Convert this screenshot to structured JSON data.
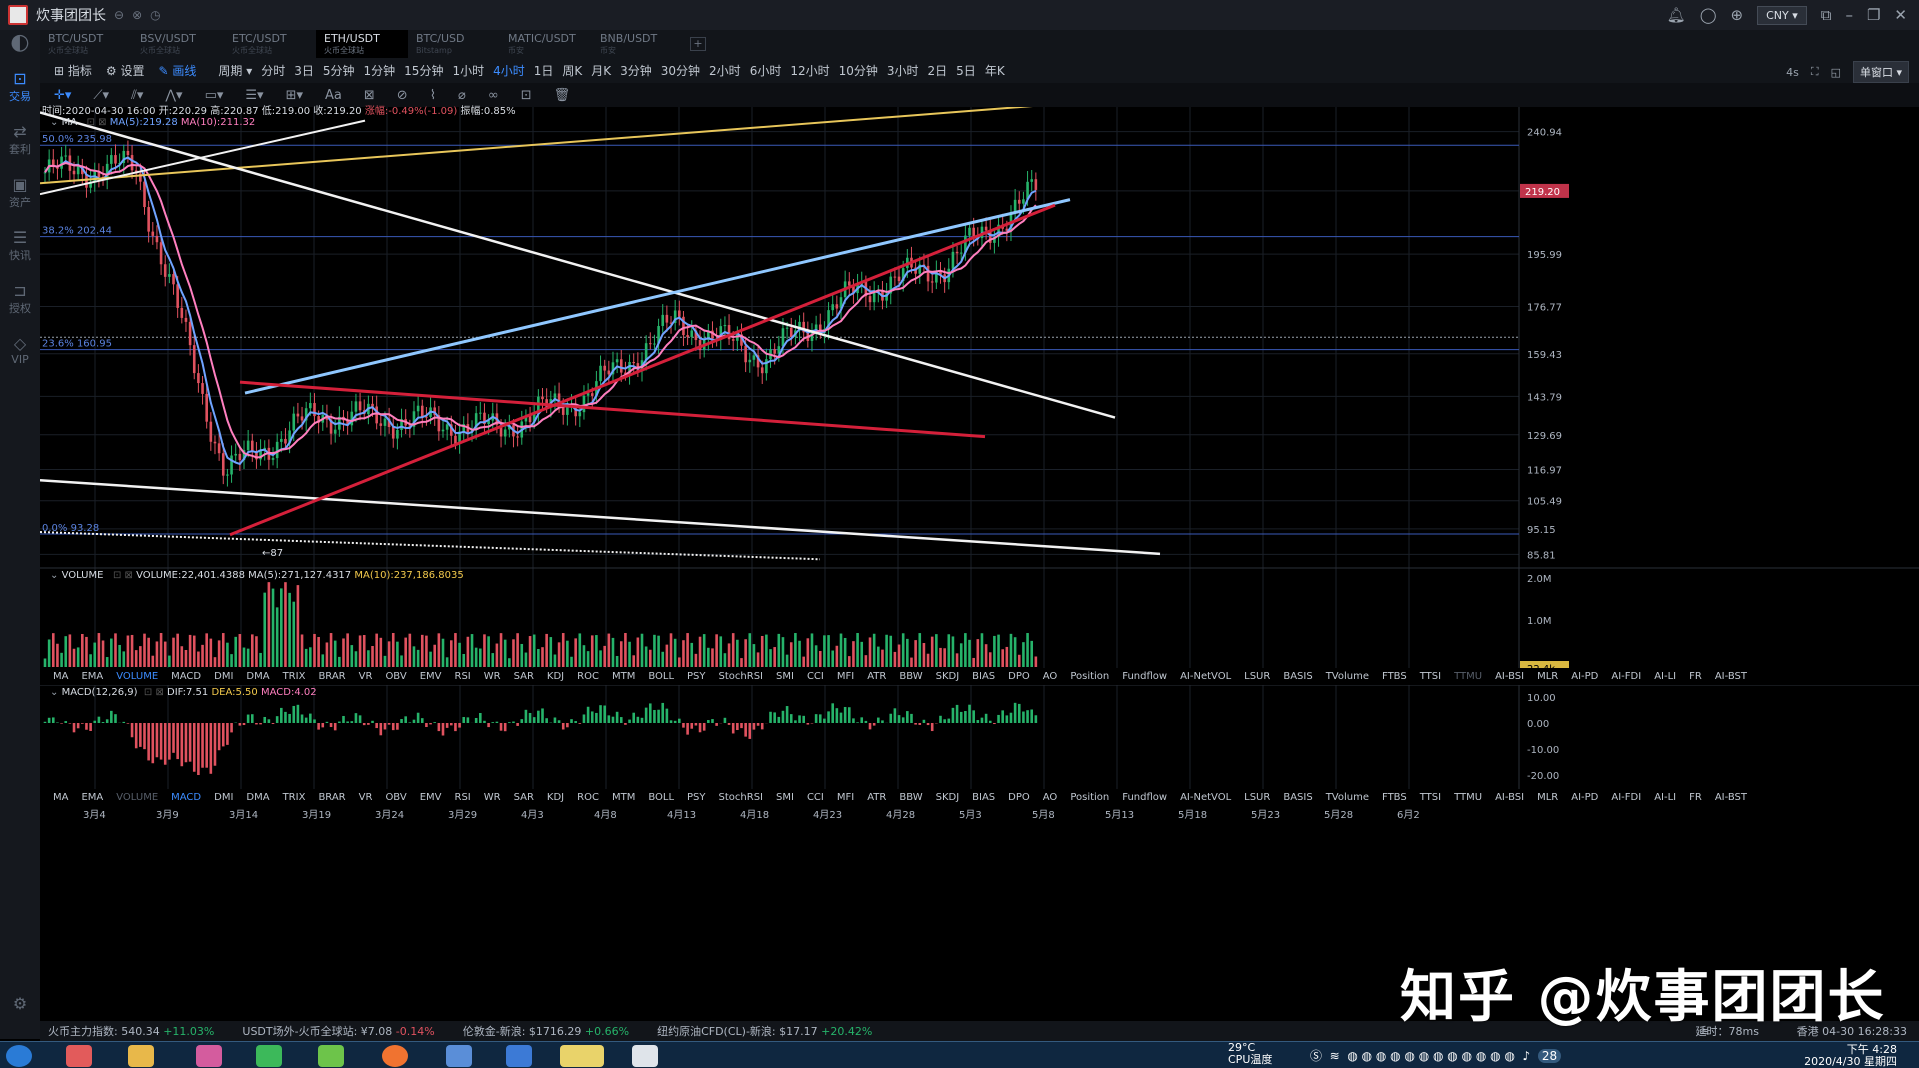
{
  "app": {
    "title": "炊事团团长"
  },
  "titlebar": {
    "currency": "CNY"
  },
  "tabs": [
    {
      "label": "BTC/USDT",
      "sub": "火币全球站"
    },
    {
      "label": "BSV/USDT",
      "sub": "火币全球站"
    },
    {
      "label": "ETC/USDT",
      "sub": "火币全球站"
    },
    {
      "label": "ETH/USDT",
      "sub": "火币全球站"
    },
    {
      "label": "BTC/USD",
      "sub": "Bitstamp"
    },
    {
      "label": "MATIC/USDT",
      "sub": "币安"
    },
    {
      "label": "BNB/USDT",
      "sub": "币安"
    }
  ],
  "tab_plus": "+",
  "sidebar": [
    {
      "label": "交易",
      "icon": "chart-icon"
    },
    {
      "label": "套利",
      "icon": "arbitrage-icon"
    },
    {
      "label": "资产",
      "icon": "asset-icon"
    },
    {
      "label": "快讯",
      "icon": "news-icon"
    },
    {
      "label": "授权",
      "icon": "auth-icon"
    },
    {
      "label": "VIP",
      "icon": "vip-icon"
    }
  ],
  "toolbar": {
    "indicator": "指标",
    "settings": "设置",
    "draw": "画线",
    "period": "周期",
    "periods": [
      "分时",
      "3日",
      "5分钟",
      "1分钟",
      "15分钟",
      "1小时",
      "4小时",
      "1日",
      "周K",
      "月K",
      "3分钟",
      "30分钟",
      "2小时",
      "6小时",
      "12小时",
      "10分钟",
      "3小时",
      "2日",
      "5日",
      "年K"
    ],
    "refresh": "4s",
    "window": "单窗口"
  },
  "draw_tools": {
    "text": "Aa"
  },
  "ohlc": {
    "time_label": "时间:2020-04-30 16:00",
    "open": "开:220.29",
    "high": "高:220.87",
    "low": "低:219.00",
    "close": "收:219.20",
    "change": "涨幅:-0.49%(-1.09)",
    "amplitude": "振幅:0.85%"
  },
  "ma_legend": {
    "name": "MA",
    "ma5": "MA(5):219.28",
    "ma10": "MA(10):211.32"
  },
  "fib_levels": [
    {
      "label": "50.0% 235.98",
      "y": 235.98
    },
    {
      "label": "38.2% 202.44",
      "y": 202.44
    },
    {
      "label": "23.6% 160.95",
      "y": 160.95
    },
    {
      "label": "0.0% 93.28",
      "y": 93.28
    }
  ],
  "price_axis": [
    "240.94",
    "219.20",
    "195.99",
    "176.77",
    "159.43",
    "143.79",
    "129.69",
    "116.97",
    "105.49",
    "95.15",
    "85.81"
  ],
  "last_price": "219.20",
  "low_marker": "←87",
  "volume_legend": {
    "name": "VOLUME",
    "volume": "VOLUME:22,401.4388",
    "ma5": "MA(5):271,127.4317",
    "ma10": "MA(10):237,186.8035"
  },
  "volume_axis": [
    "2.0M",
    "1.0M"
  ],
  "volume_last": "22.4k",
  "macd_legend": {
    "name": "MACD(12,26,9)",
    "dif": "DIF:7.51",
    "dea": "DEA:5.50",
    "macd": "MACD:4.02"
  },
  "macd_axis": [
    "10.00",
    "0.00",
    "-10.00",
    "-20.00"
  ],
  "indicators": [
    "MA",
    "EMA",
    "VOLUME",
    "MACD",
    "DMI",
    "DMA",
    "TRIX",
    "BRAR",
    "VR",
    "OBV",
    "EMV",
    "RSI",
    "WR",
    "SAR",
    "KDJ",
    "ROC",
    "MTM",
    "BOLL",
    "PSY",
    "StochRSI",
    "SMI",
    "CCI",
    "MFI",
    "ATR",
    "BBW",
    "SKDJ",
    "BIAS",
    "DPO",
    "AO",
    "Position",
    "Fundflow",
    "AI-NetVOL",
    "LSUR",
    "BASIS",
    "TVolume",
    "FTBS",
    "TTSI",
    "TTMU",
    "AI-BSI",
    "MLR",
    "AI-PD",
    "AI-FDI",
    "AI-LI",
    "FR",
    "AI-BST"
  ],
  "date_axis": [
    "3月4",
    "3月9",
    "3月14",
    "3月19",
    "3月24",
    "3月29",
    "4月3",
    "4月8",
    "4月13",
    "4月18",
    "4月23",
    "4月28",
    "5月3",
    "5月8",
    "5月13",
    "5月18",
    "5月23",
    "5月28",
    "6月2"
  ],
  "statusbar": [
    {
      "label": "火币主力指数:",
      "value": "540.34",
      "change": "+11.03%"
    },
    {
      "label": "USDT场外-火币全球站:",
      "value": "¥7.08",
      "change": "-0.14%"
    },
    {
      "label": "伦敦金-新浪:",
      "value": "$1716.29",
      "change": "+0.66%"
    },
    {
      "label": "纽约原油CFD(CL)-新浪:",
      "value": "$17.17",
      "change": "+20.42%"
    }
  ],
  "status_right": {
    "latency": "延时：78ms",
    "exchange_time": "香港 04-30 16:28:33"
  },
  "taskbar": {
    "temp": "29°C",
    "temp_label": "CPU温度",
    "time": "下午 4:28",
    "date": "2020/4/30 星期四",
    "badge": "28"
  },
  "watermark": "知乎 @炊事团团长",
  "colors": {
    "up": "#26b36a",
    "down": "#e0525f",
    "accent": "#3c8cff",
    "ma5": "#6fa3ff",
    "ma10": "#ff7fbf"
  },
  "chart_data": {
    "type": "candlestick",
    "symbol": "ETH/USDT",
    "interval": "4小时",
    "x": [
      "3月4",
      "3月9",
      "3月14",
      "3月19",
      "3月24",
      "3月29",
      "4月3",
      "4月8",
      "4月13",
      "4月18",
      "4月23",
      "4月28"
    ],
    "close": [
      226,
      228,
      116,
      137,
      135,
      132,
      144,
      171,
      158,
      182,
      192,
      219
    ],
    "ylim": [
      83,
      250
    ],
    "volume_x_max": 2000000
  }
}
